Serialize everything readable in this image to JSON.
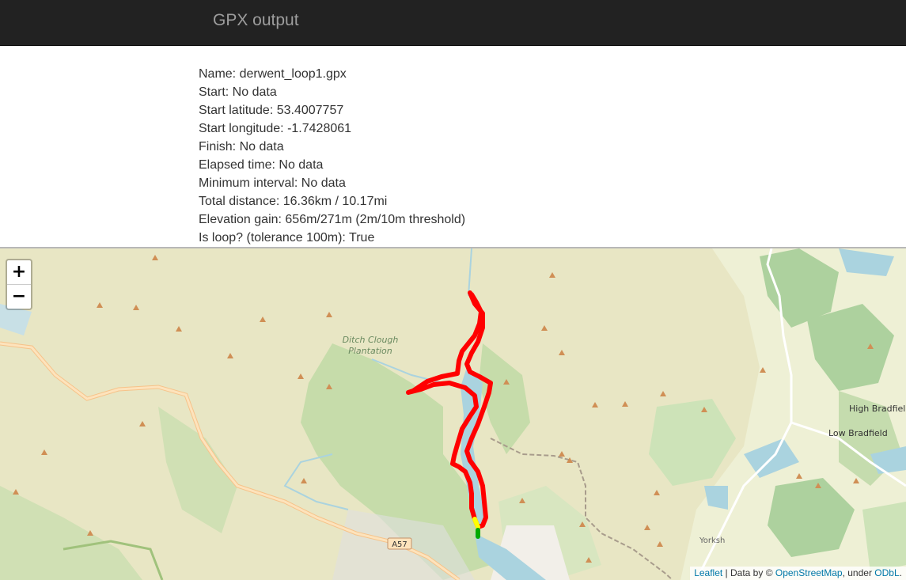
{
  "navbar": {
    "title": "GPX output"
  },
  "info": {
    "name": "Name: derwent_loop1.gpx",
    "start": "Start: No data",
    "start_latitude": "Start latitude: 53.4007757",
    "start_longitude": "Start longitude: -1.7428061",
    "finish": "Finish: No data",
    "elapsed_time": "Elapsed time: No data",
    "minimum_interval": "Minimum interval: No data",
    "total_distance": "Total distance: 16.36km / 10.17mi",
    "elevation_gain": "Elevation gain: 656m/271m (2m/10m threshold)",
    "is_loop": "Is loop? (tolerance 100m): True"
  },
  "map": {
    "zoom_in": "+",
    "zoom_out": "−",
    "labels": {
      "plantation_1": "Ditch Clough",
      "plantation_2": "Plantation",
      "high_bradfield": "High Bradfield",
      "low_bradfield": "Low Bradfield",
      "road_a57": "A57",
      "yorks": "Yorksh"
    },
    "attribution": {
      "leaflet": "Leaflet",
      "separator": " | Data by © ",
      "osm": "OpenStreetMap",
      "under": ", under ",
      "odbl": "ODbL",
      "period": "."
    },
    "colors": {
      "route": "#ff0000",
      "water": "#aad3df",
      "woodland": "#add19e",
      "moor": "#e8e6c4",
      "farmland": "#eef0d5",
      "peak": "#d08f55",
      "start_marker": "#ffff00",
      "end_marker": "#00aa00"
    }
  }
}
